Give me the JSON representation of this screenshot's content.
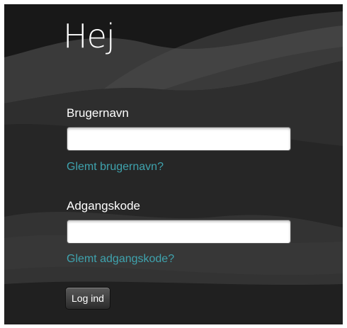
{
  "greeting": "Hej",
  "username": {
    "label": "Brugernavn",
    "value": "",
    "forgot_link": "Glemt brugernavn?"
  },
  "password": {
    "label": "Adgangskode",
    "value": "",
    "forgot_link": "Glemt adgangskode?"
  },
  "login_button": "Log ind",
  "colors": {
    "background": "#2a2a2a",
    "link": "#3fa3ae",
    "text": "#ffffff"
  }
}
